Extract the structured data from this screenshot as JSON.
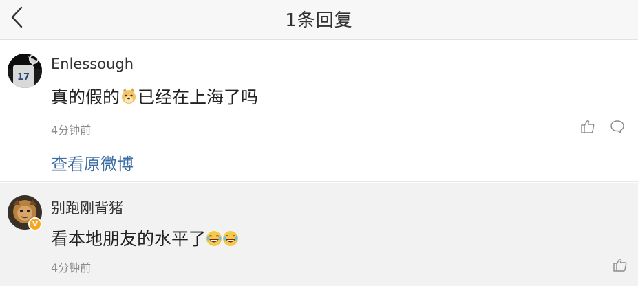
{
  "header": {
    "title": "1条回复"
  },
  "comment": {
    "username": "Enlessough",
    "text_before": "真的假的",
    "emoji_1": "doge-emoji",
    "text_after": "已经在上海了吗",
    "time": "4分钟前",
    "view_original": "查看原微博"
  },
  "reply": {
    "username": "别跑刚背猪",
    "text": "看本地朋友的水平了",
    "emoji": "laugh-cry-emoji",
    "verified_badge": "V",
    "time": "4分钟前"
  },
  "colors": {
    "link": "#3c6da3",
    "verified": "#f5a623"
  }
}
